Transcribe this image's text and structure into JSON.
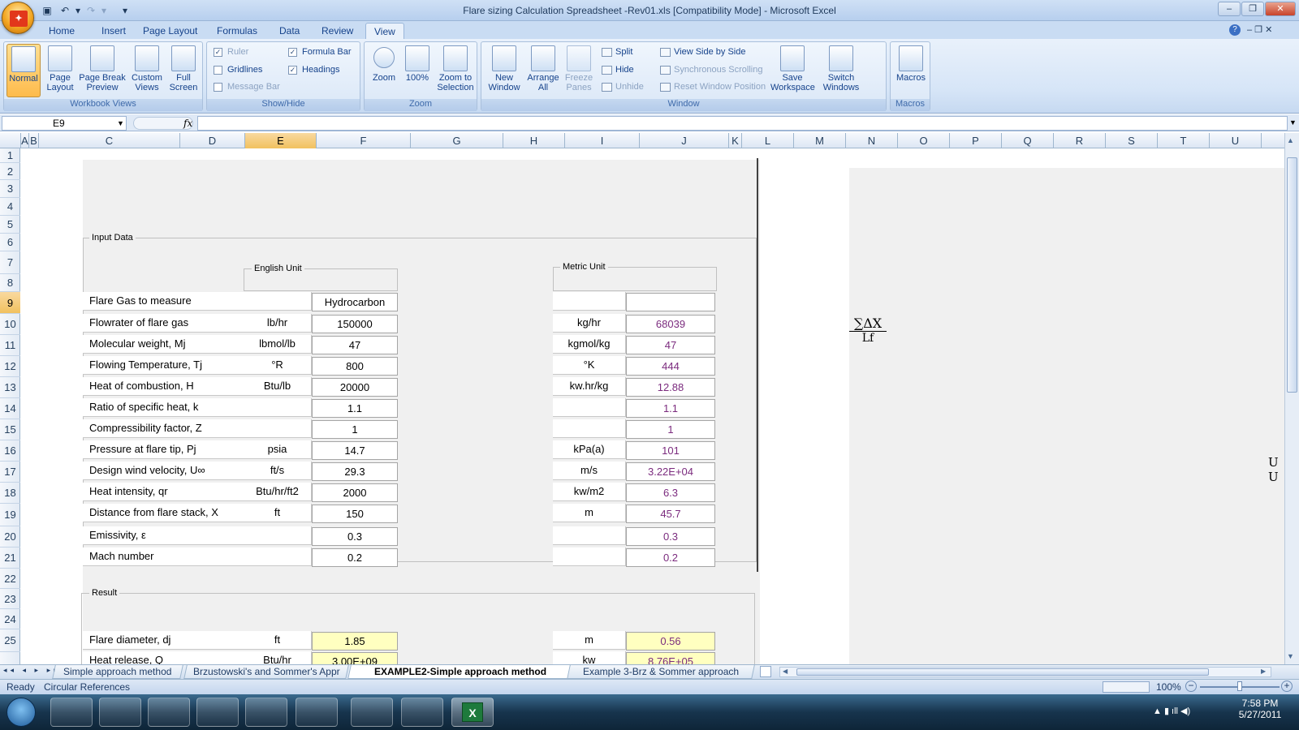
{
  "window": {
    "title": "Flare sizing Calculation Spreadsheet -Rev01.xls  [Compatibility Mode] - Microsoft Excel"
  },
  "ribbon": {
    "tabs": [
      "Home",
      "Insert",
      "Page Layout",
      "Formulas",
      "Data",
      "Review",
      "View"
    ],
    "workbook_views": {
      "label": "Workbook Views",
      "buttons": [
        "Normal",
        "Page Layout",
        "Page Break Preview",
        "Custom Views",
        "Full Screen"
      ]
    },
    "show_hide": {
      "label": "Show/Hide",
      "ruler": "Ruler",
      "gridlines": "Gridlines",
      "message_bar": "Message Bar",
      "formula_bar": "Formula Bar",
      "headings": "Headings"
    },
    "zoom": {
      "label": "Zoom",
      "zoom": "Zoom",
      "hundred": "100%",
      "zoom_sel": "Zoom to Selection"
    },
    "window": {
      "label": "Window",
      "new_window": "New Window",
      "arrange_all": "Arrange All",
      "freeze": "Freeze Panes",
      "split": "Split",
      "hide": "Hide",
      "unhide": "Unhide",
      "side_by_side": "View Side by Side",
      "sync_scroll": "Synchronous Scrolling",
      "reset_pos": "Reset Window Position",
      "save_ws": "Save Workspace",
      "switch_win": "Switch Windows"
    },
    "macros": {
      "label": "Macros",
      "button": "Macros"
    }
  },
  "formula_bar": {
    "name_box": "E9",
    "fx": "fx",
    "value": ""
  },
  "columns": [
    "A",
    "B",
    "C",
    "D",
    "E",
    "F",
    "G",
    "H",
    "I",
    "J",
    "K",
    "L",
    "M",
    "N",
    "O",
    "P",
    "Q",
    "R",
    "S",
    "T",
    "U"
  ],
  "rows": [
    "1",
    "2",
    "3",
    "4",
    "5",
    "6",
    "7",
    "8",
    "9",
    "10",
    "11",
    "12",
    "13",
    "14",
    "15",
    "16",
    "17",
    "18",
    "19",
    "20",
    "21",
    "22",
    "23",
    "24",
    "25"
  ],
  "input_data": {
    "group_label": "Input Data",
    "english_label": "English Unit",
    "metric_label": "Metric Unit",
    "rows": [
      {
        "label": "Flare Gas to measure",
        "eu": "",
        "ev": "Hydrocarbon",
        "mu": "",
        "mv": ""
      },
      {
        "label": "Flowrater of flare gas",
        "eu": "lb/hr",
        "ev": "150000",
        "mu": "kg/hr",
        "mv": "68039"
      },
      {
        "label": "Molecular weight, Mj",
        "eu": "lbmol/lb",
        "ev": "47",
        "mu": "kgmol/kg",
        "mv": "47"
      },
      {
        "label": "Flowing Temperature, Tj",
        "eu": "°R",
        "ev": "800",
        "mu": "°K",
        "mv": "444"
      },
      {
        "label": "Heat of combustion, H",
        "eu": "Btu/lb",
        "ev": "20000",
        "mu": "kw.hr/kg",
        "mv": "12.88"
      },
      {
        "label": "Ratio of specific heat, k",
        "eu": "",
        "ev": "1.1",
        "mu": "",
        "mv": "1.1"
      },
      {
        "label": "Compressibility factor, Z",
        "eu": "",
        "ev": "1",
        "mu": "",
        "mv": "1"
      },
      {
        "label": "Pressure at flare tip, Pj",
        "eu": "psia",
        "ev": "14.7",
        "mu": "kPa(a)",
        "mv": "101"
      },
      {
        "label": "Design wind velocity, U∞",
        "eu": "ft/s",
        "ev": "29.3",
        "mu": "m/s",
        "mv": "3.22E+04"
      },
      {
        "label": "Heat intensity, qr",
        "eu": "Btu/hr/ft2",
        "ev": "2000",
        "mu": "kw/m2",
        "mv": "6.3"
      },
      {
        "label": "Distance from flare stack, X",
        "eu": "ft",
        "ev": "150",
        "mu": "m",
        "mv": "45.7"
      },
      {
        "label": "Emissivity, ε",
        "eu": "",
        "ev": "0.3",
        "mu": "",
        "mv": "0.3"
      },
      {
        "label": "Mach number",
        "eu": "",
        "ev": "0.2",
        "mu": "",
        "mv": "0.2"
      }
    ]
  },
  "result": {
    "group_label": "Result",
    "rows": [
      {
        "label": "Flare diameter, dj",
        "eu": "ft",
        "ev": "1.85",
        "mu": "m",
        "mv": "0.56"
      },
      {
        "label": "Heat release, Q",
        "eu": "Btu/hr",
        "ev": "3.00E+09",
        "mu": "kw",
        "mv": "8.76E+05"
      }
    ]
  },
  "formula_image": {
    "numerator": "∑ΔX",
    "denominator": "Lf"
  },
  "sheet_tabs": [
    "Simple approach method",
    "Brzustowski's and Sommer's Appr",
    "EXAMPLE2-Simple approach method",
    "Example 3-Brz & Sommer approach"
  ],
  "status": {
    "ready": "Ready",
    "circ": "Circular References",
    "zoom": "100%"
  },
  "taskbar": {
    "time": "7:58 PM",
    "date": "5/27/2011"
  }
}
